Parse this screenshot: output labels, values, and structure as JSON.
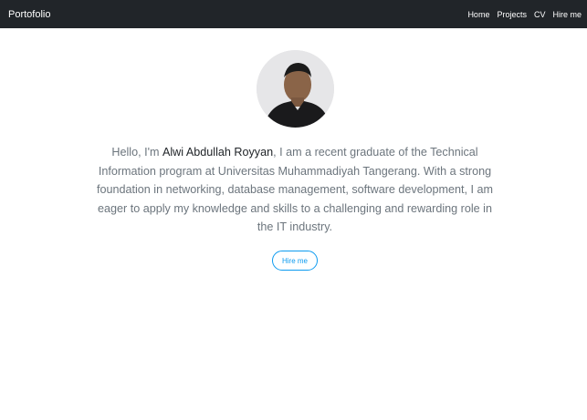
{
  "navbar": {
    "brand": "Portofolio",
    "links": [
      "Home",
      "Projects",
      "CV",
      "Hire me"
    ]
  },
  "profile": {
    "greeting": "Hello, I'm ",
    "name": "Alwi Abdullah Royyan",
    "description": ", I am a recent graduate of the Technical Information program at Universitas Muhammadiyah Tangerang. With a strong foundation in networking, database management, software development, I am eager to apply my knowledge and skills to a challenging and rewarding role in the IT industry.",
    "button_label": "Hire me"
  },
  "colors": {
    "navbar_bg": "#212529",
    "accent": "#0d9bf0",
    "text_muted": "#6c757d"
  }
}
